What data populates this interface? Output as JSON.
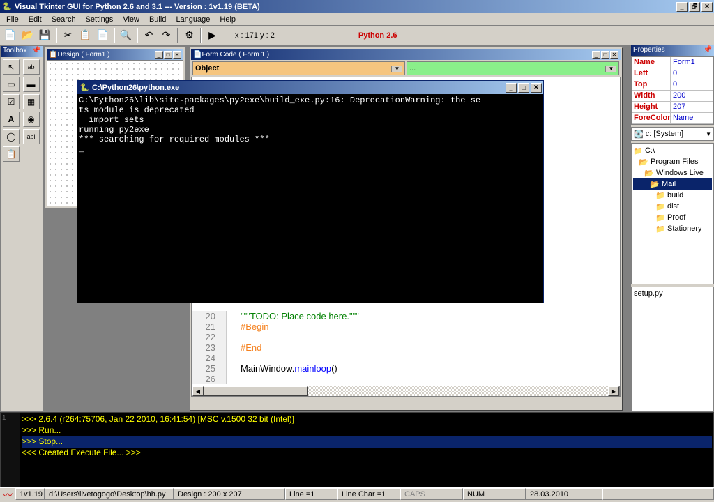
{
  "app": {
    "title": "Visual Tkinter GUI for Python 2.6 and 3.1 --- Version : 1v1.19 (BETA)"
  },
  "menu": [
    "File",
    "Edit",
    "Search",
    "Settings",
    "View",
    "Build",
    "Language",
    "Help"
  ],
  "toolbar": {
    "coords": "x : 171   y : 2",
    "python_version": "Python 2.6"
  },
  "toolbox": {
    "title": "Toolbox"
  },
  "design_window": {
    "title": "Design ( Form1 )"
  },
  "code_window": {
    "title": "Form Code ( Form 1 )",
    "combo_object": "Object",
    "combo_event": "...",
    "lines": [
      {
        "num": "20",
        "code": "\"\"\"TODO: Place code here.\"\"\"",
        "cls": "str"
      },
      {
        "num": "21",
        "code": "#Begin",
        "cls": "comm"
      },
      {
        "num": "22",
        "code": "",
        "cls": ""
      },
      {
        "num": "23",
        "code": "#End",
        "cls": "comm"
      },
      {
        "num": "24",
        "code": "",
        "cls": ""
      },
      {
        "num": "25",
        "code": "MainWindow.mainloop()",
        "cls": "kw2"
      },
      {
        "num": "26",
        "code": "",
        "cls": ""
      }
    ]
  },
  "console": {
    "title": "C:\\Python26\\python.exe",
    "body": "C:\\Python26\\lib\\site-packages\\py2exe\\build_exe.py:16: DeprecationWarning: the se\nts module is deprecated\n  import sets\nrunning py2exe\n*** searching for required modules ***\n_"
  },
  "properties": {
    "title": "Properties",
    "rows": [
      {
        "name": "Name",
        "value": "Form1"
      },
      {
        "name": "Left",
        "value": "0"
      },
      {
        "name": "Top",
        "value": "0"
      },
      {
        "name": "Width",
        "value": "200"
      },
      {
        "name": "Height",
        "value": "207"
      },
      {
        "name": "ForeColor",
        "value": "Name"
      }
    ],
    "drive": "c: [System]",
    "tree": [
      {
        "label": "C:\\",
        "depth": 0,
        "sel": false
      },
      {
        "label": "Program Files",
        "depth": 1,
        "sel": false
      },
      {
        "label": "Windows Live",
        "depth": 2,
        "sel": false
      },
      {
        "label": "Mail",
        "depth": 3,
        "sel": true
      },
      {
        "label": "build",
        "depth": 4,
        "sel": false
      },
      {
        "label": "dist",
        "depth": 4,
        "sel": false
      },
      {
        "label": "Proof",
        "depth": 4,
        "sel": false
      },
      {
        "label": "Stationery",
        "depth": 4,
        "sel": false
      }
    ],
    "file": "setup.py"
  },
  "bottom_console": {
    "margin": "1",
    "lines": [
      {
        "text": ">>> 2.6.4 (r264:75706, Jan 22 2010, 16:41:54) [MSC v.1500 32 bit (Intel)]",
        "sel": false
      },
      {
        "text": ">>> Run...",
        "sel": false
      },
      {
        "text": ">>> Stop...",
        "sel": true
      },
      {
        "text": "<<< Created Execute File... >>>",
        "sel": false
      }
    ]
  },
  "statusbar": {
    "version": "1v1.19",
    "file": "d:\\Users\\livetogogo\\Desktop\\hh.py",
    "design": "Design : 200 x 207",
    "line": "Line =1",
    "linechar": "Line Char =1",
    "caps": "CAPS",
    "num": "NUM",
    "date": "28.03.2010"
  }
}
